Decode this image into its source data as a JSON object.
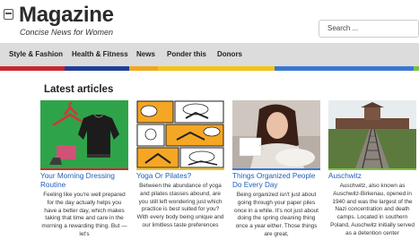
{
  "site": {
    "title": "Magazine",
    "tagline": "Concise News for Women"
  },
  "search": {
    "placeholder": "Search ..."
  },
  "nav": {
    "items": [
      "Style & Fashion",
      "Health & Fitness",
      "News",
      "Ponder this",
      "Donors"
    ]
  },
  "colors": {
    "style": "#c8282e",
    "health": "#1f3f98",
    "news": "#f0a81e",
    "ponder": "#f3c419",
    "donors": "#3a78d0",
    "extra": "#7ac142",
    "link": "#1e5fb8"
  },
  "main": {
    "section_title": "Latest articles",
    "articles": [
      {
        "title": "Your Morning Dressing Routine",
        "excerpt": "Feeling like you're well prepared for the day actually helps you have a better day, which makes taking that time and care in the morning a rewarding thing. But — let's",
        "image": "clothes-hanger-illustration"
      },
      {
        "title": "Yoga Or Pilates?",
        "excerpt": "Between the abundance of yoga and pilates classes abound, are you still left wondering just which practice is best suited for you? With every body being unique and our limitless taste preferences",
        "image": "comic-yoga-illustration"
      },
      {
        "title": "Things Organized People Do Every Day",
        "excerpt": "Being organized isn't just about going through your paper piles once in a while. It's not just about doing the spring cleaning thing once a year either. Those things are great,",
        "image": "woman-with-coffee-photo"
      },
      {
        "title": "Auschwitz",
        "excerpt": "Auschwitz, also known as Auschwitz-Birkenau, opened in 1940 and was the largest of the Nazi concentration and death camps. Located in southern Poland, Auschwitz initially served as a detention center",
        "image": "railway-tracks-photo"
      }
    ]
  }
}
